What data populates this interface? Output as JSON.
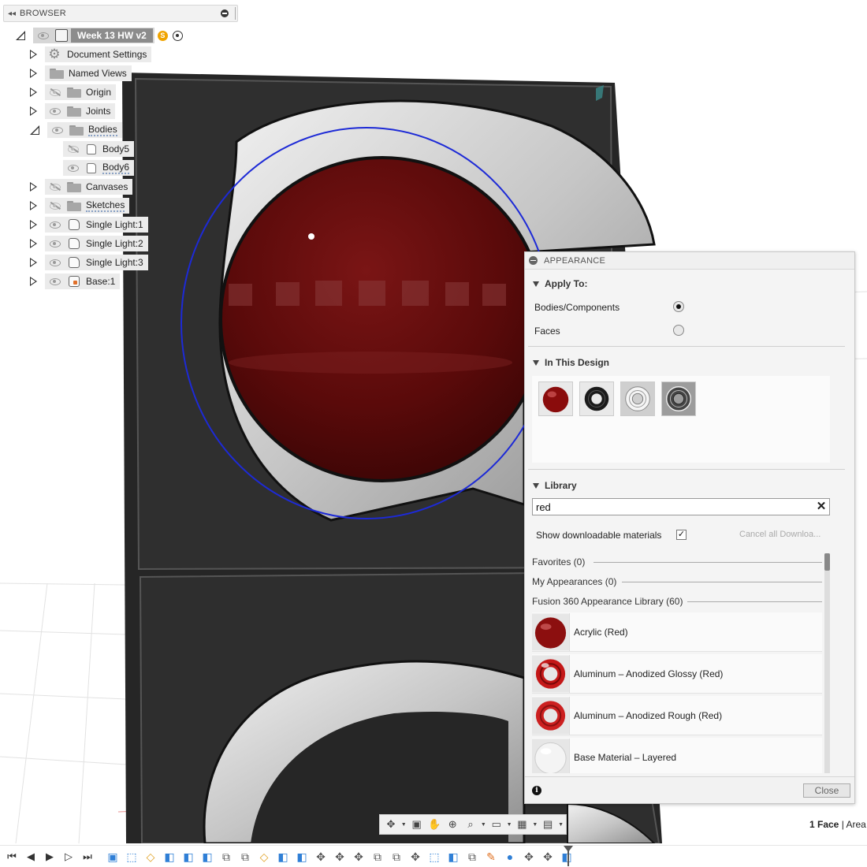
{
  "browser": {
    "title": "BROWSER",
    "root": {
      "label": "Week 13 HW v2",
      "badge": "S"
    },
    "items": [
      {
        "label": "Document Settings",
        "icon": "gear-icon",
        "visible": true
      },
      {
        "label": "Named Views",
        "icon": "folder-icon",
        "visible": true
      },
      {
        "label": "Origin",
        "icon": "folder-icon",
        "visible": false
      },
      {
        "label": "Joints",
        "icon": "folder-icon",
        "visible": true
      },
      {
        "label": "Bodies",
        "icon": "folder-icon",
        "visible": true,
        "expanded": true
      },
      {
        "label": "Body5",
        "icon": "body-icon",
        "visible": false
      },
      {
        "label": "Body6",
        "icon": "body-icon",
        "visible": true
      },
      {
        "label": "Canvases",
        "icon": "folder-icon",
        "visible": false
      },
      {
        "label": "Sketches",
        "icon": "folder-icon",
        "visible": false
      },
      {
        "label": "Single Light:1",
        "icon": "component-icon",
        "visible": true
      },
      {
        "label": "Single Light:2",
        "icon": "component-icon",
        "visible": true
      },
      {
        "label": "Single Light:3",
        "icon": "component-icon",
        "visible": true
      },
      {
        "label": "Base:1",
        "icon": "component-icon",
        "visible": true
      }
    ]
  },
  "appearance": {
    "title": "APPEARANCE",
    "apply_to": {
      "label": "Apply To:",
      "options": [
        "Bodies/Components",
        "Faces"
      ],
      "selected": "Bodies/Components"
    },
    "in_this_design": {
      "label": "In This Design",
      "swatches": [
        "red-glossy-sphere",
        "black-torus",
        "chrome-torus",
        "dark-chrome-torus"
      ]
    },
    "library": {
      "label": "Library",
      "search_value": "red",
      "show_downloadable_label": "Show downloadable materials",
      "show_downloadable_checked": true,
      "cancel_downloads_label": "Cancel all Downloa...",
      "categories": [
        "Favorites (0)",
        "My Appearances (0)",
        "Fusion 360 Appearance Library (60)"
      ],
      "items": [
        {
          "name": "Acrylic (Red)",
          "thumb": "red-sphere"
        },
        {
          "name": "Aluminum – Anodized Glossy (Red)",
          "thumb": "red-glossy-torus"
        },
        {
          "name": "Aluminum – Anodized Rough (Red)",
          "thumb": "red-rough-torus"
        },
        {
          "name": "Base Material – Layered",
          "thumb": "white-sphere"
        }
      ]
    },
    "close_label": "Close"
  },
  "status": {
    "selection": "1 Face",
    "separator": "|",
    "area_label": "Area"
  },
  "colors": {
    "lens_red": "#5a0a0a",
    "housing_black": "#2b2b2b",
    "visor_grey": "#c9c9c9",
    "selection_blue": "#1d2ad6",
    "timeline_blue": "#2f7fd6"
  }
}
